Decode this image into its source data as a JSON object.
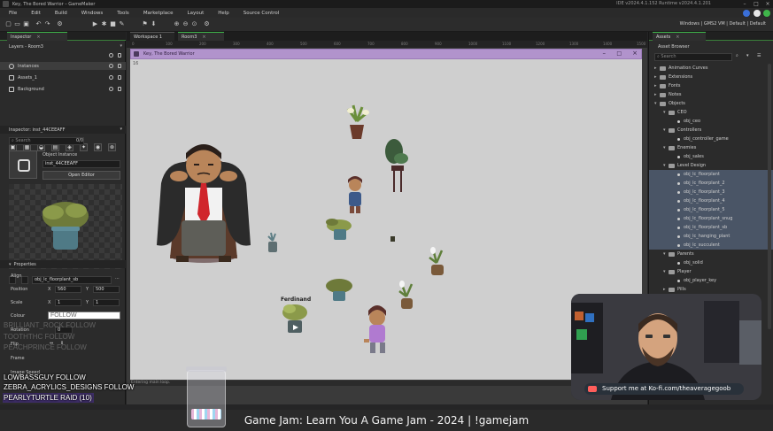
{
  "window": {
    "title": "Key, The Bored Warrior – GameMaker",
    "ide_version": "IDE v2024.4.1.152   Runtime v2024.4.1.201"
  },
  "menu": [
    "File",
    "Edit",
    "Build",
    "Windows",
    "Tools",
    "Marketplace",
    "Layout",
    "Help",
    "Source Control"
  ],
  "targets": "Windows | GMS2 VM | Default | Default",
  "left_dock": {
    "tab": "Inspector",
    "room_tab": "Layers - Room3",
    "layers": [
      {
        "name": "Instances"
      },
      {
        "name": "Assets_1"
      },
      {
        "name": "Background"
      }
    ],
    "inspector_tab": "Inspector: inst_44CEEAFF",
    "search_placeholder": "Search",
    "search_count": "0/0",
    "object_instance_label": "Object Instance",
    "instance_name": "inst_44CEEAFF",
    "open_editor": "Open Editor",
    "sprite_name": "obj_lc_floorplant_sb",
    "properties_header": "Properties",
    "align_label": "Align",
    "position_label": "Position",
    "position_x": "560",
    "position_y": "500",
    "scale_label": "Scale",
    "scale_x": "1",
    "scale_y": "1",
    "colour_label": "Colour",
    "rotation_label": "Rotation",
    "rotation_value": "0",
    "flip_label": "Flip",
    "frame_label": "Frame",
    "image_speed_label": "Image Speed",
    "x_label": "X",
    "y_label": "Y"
  },
  "editor": {
    "tabs": [
      "Workspace 1",
      "Room3"
    ],
    "game_window_title": "Key, The Bored Warrior",
    "fps": "16",
    "npc_label": "Ferdinand",
    "status": "Entering main loop.",
    "ruler": [
      "0",
      "100",
      "200",
      "300",
      "400",
      "500",
      "600",
      "700",
      "800",
      "900",
      "1000",
      "1100",
      "1200",
      "1300",
      "1400",
      "1500"
    ]
  },
  "right_dock": {
    "tab": "Assets",
    "browser_title": "Asset Browser",
    "search_placeholder": "Search",
    "tree": [
      {
        "label": "Animation Curves",
        "type": "folder",
        "depth": 0
      },
      {
        "label": "Extensions",
        "type": "folder",
        "depth": 0
      },
      {
        "label": "Fonts",
        "type": "folder",
        "depth": 0
      },
      {
        "label": "Notes",
        "type": "folder",
        "depth": 0
      },
      {
        "label": "Objects",
        "type": "folder",
        "depth": 0,
        "open": true
      },
      {
        "label": "CEO",
        "type": "folder",
        "depth": 1,
        "open": true
      },
      {
        "label": "obj_ceo",
        "type": "object",
        "depth": 2
      },
      {
        "label": "Controllers",
        "type": "folder",
        "depth": 1,
        "open": true
      },
      {
        "label": "obj_controller_game",
        "type": "object",
        "depth": 2
      },
      {
        "label": "Enemies",
        "type": "folder",
        "depth": 1,
        "open": true
      },
      {
        "label": "obj_sales",
        "type": "object",
        "depth": 2
      },
      {
        "label": "Level Design",
        "type": "folder",
        "depth": 1,
        "open": true
      },
      {
        "label": "obj_lc_floorplant",
        "type": "object",
        "depth": 2,
        "hl": true
      },
      {
        "label": "obj_lc_floorplant_2",
        "type": "object",
        "depth": 2,
        "hl": true
      },
      {
        "label": "obj_lc_floorplant_3",
        "type": "object",
        "depth": 2,
        "hl": true
      },
      {
        "label": "obj_lc_floorplant_4",
        "type": "object",
        "depth": 2,
        "hl": true
      },
      {
        "label": "obj_lc_floorplant_5",
        "type": "object",
        "depth": 2,
        "hl": true
      },
      {
        "label": "obj_lc_floorplant_snug",
        "type": "object",
        "depth": 2,
        "hl": true
      },
      {
        "label": "obj_lc_floorplant_sb",
        "type": "object",
        "depth": 2,
        "hl": true
      },
      {
        "label": "obj_lc_hanging_plant",
        "type": "object",
        "depth": 2,
        "hl": true
      },
      {
        "label": "obj_lc_succulent",
        "type": "object",
        "depth": 2,
        "hl": true
      },
      {
        "label": "Parents",
        "type": "folder",
        "depth": 1,
        "open": true
      },
      {
        "label": "obj_solid",
        "type": "object",
        "depth": 2
      },
      {
        "label": "Player",
        "type": "folder",
        "depth": 1,
        "open": true
      },
      {
        "label": "obj_player_key",
        "type": "object",
        "depth": 2
      },
      {
        "label": "Pills",
        "type": "folder",
        "depth": 1
      }
    ]
  },
  "stream": {
    "chat": [
      {
        "text": "LOWBASSGUY  FOLLOW"
      },
      {
        "text": "ZEBRA_ACRYLICS_DESIGNS  FOLLOW"
      },
      {
        "text": "PEARLYTURTLE  RAID (10)"
      }
    ],
    "ghost_chat": [
      "BRILLIANT_ROCK  FOLLOW",
      "TOOTHTHC  FOLLOW",
      "PEACHPRINCE  FOLLOW"
    ],
    "colour_follow": "FOLLOW",
    "kofi": "Support me at Ko-fi.com/theaveragegoob",
    "title": "Game Jam: Learn You A Game Jam - 2024 | !gamejam"
  },
  "colors": {
    "accent_green": "#3fb54a",
    "game_window_bar": "#b193cc",
    "canvas_bg": "#cfcfcf",
    "asset_highlight": "#4a5566",
    "kofi_cup": "#ff5e5b"
  }
}
